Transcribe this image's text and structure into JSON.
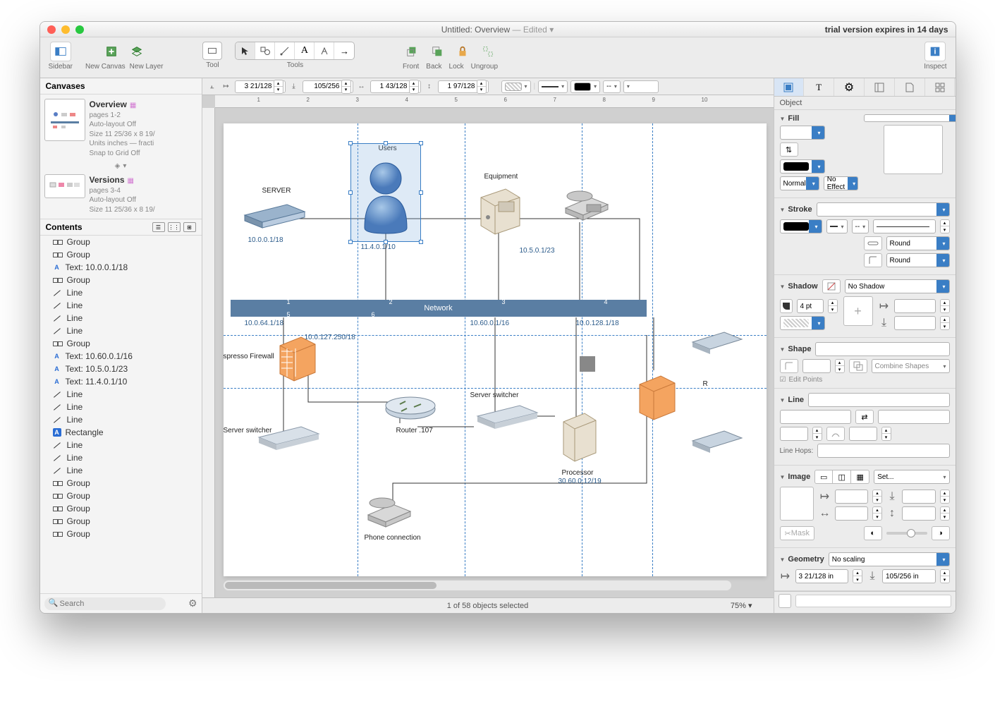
{
  "title": {
    "doc": "Untitled: Overview",
    "edited": "— Edited",
    "dropdown": "▾"
  },
  "trial": "trial version expires in 14 days",
  "toolbar": {
    "sidebar": "Sidebar",
    "new_canvas": "New Canvas",
    "new_layer": "New Layer",
    "tool": "Tool",
    "tools": "Tools",
    "front": "Front",
    "back": "Back",
    "lock": "Lock",
    "ungroup": "Ungroup",
    "inspect": "Inspect"
  },
  "coords": {
    "x": "3 21/128",
    "y": "105/256",
    "w": "1 43/128",
    "h": "1 97/128",
    "dash": "--"
  },
  "sidebar": {
    "canvases_label": "Canvases",
    "canvas1": {
      "name": "Overview",
      "pages": "pages 1-2",
      "auto": "Auto-layout Off",
      "size": "Size 11 25/36 x 8 19/",
      "units": "Units inches — fracti",
      "snap": "Snap to Grid Off"
    },
    "canvas2": {
      "name": "Versions",
      "pages": "pages 3-4",
      "auto": "Auto-layout Off",
      "size": "Size 11 25/36 x 8 19/"
    },
    "contents_label": "Contents",
    "items": [
      {
        "type": "group",
        "label": "Group"
      },
      {
        "type": "group",
        "label": "Group"
      },
      {
        "type": "textA",
        "label": "Text: 10.0.0.1/18"
      },
      {
        "type": "group",
        "label": "Group"
      },
      {
        "type": "line",
        "label": "Line"
      },
      {
        "type": "line",
        "label": "Line"
      },
      {
        "type": "line",
        "label": "Line"
      },
      {
        "type": "line",
        "label": "Line"
      },
      {
        "type": "group",
        "label": "Group"
      },
      {
        "type": "textA",
        "label": "Text: 10.60.0.1/16"
      },
      {
        "type": "textA",
        "label": "Text: 10.5.0.1/23"
      },
      {
        "type": "textA",
        "label": "Text: 11.4.0.1/10"
      },
      {
        "type": "line",
        "label": "Line"
      },
      {
        "type": "line",
        "label": "Line"
      },
      {
        "type": "line",
        "label": "Line"
      },
      {
        "type": "rect",
        "label": "Rectangle"
      },
      {
        "type": "line",
        "label": "Line"
      },
      {
        "type": "line",
        "label": "Line"
      },
      {
        "type": "line",
        "label": "Line"
      },
      {
        "type": "group",
        "label": "Group"
      },
      {
        "type": "group",
        "label": "Group"
      },
      {
        "type": "group",
        "label": "Group"
      },
      {
        "type": "group",
        "label": "Group"
      },
      {
        "type": "group",
        "label": "Group"
      }
    ],
    "search_placeholder": "Search"
  },
  "diagram": {
    "server": "SERVER",
    "server_ip": "10.0.0.1/18",
    "users": "Users",
    "users_ip": "11.4.0.1/10",
    "equipment": "Equipment",
    "equip_ip": "10.5.0.1/23",
    "network": "Network",
    "net1": "10.0.64.1/18",
    "net2": "10.60.0.1/16",
    "net3": "10.0.128.1/18",
    "fw_ip": "10.0.127.250/18",
    "fw_label": "spresso Firewall",
    "switcher1": "Server switcher",
    "switcher2": "Server switcher",
    "router": "Router .107",
    "processor": "Processor",
    "processor_ip": "30.60.0.12/19",
    "phone": "Phone connection",
    "r": "R"
  },
  "status": {
    "selection": "1 of 58 objects selected",
    "zoom": "75%"
  },
  "inspector": {
    "tab_label": "Object",
    "fill": "Fill",
    "normal": "Normal",
    "no_effect": "No Effect",
    "stroke": "Stroke",
    "round": "Round",
    "shadow": "Shadow",
    "no_shadow": "No Shadow",
    "shadow_size": "4 pt",
    "shape": "Shape",
    "combine": "Combine Shapes",
    "edit_points": "Edit Points",
    "line": "Line",
    "line_hops": "Line Hops:",
    "image": "Image",
    "set": "Set...",
    "mask": "Mask",
    "geometry": "Geometry",
    "no_scaling": "No scaling",
    "geo_x": "3 21/128 in",
    "geo_y": "105/256 in"
  }
}
